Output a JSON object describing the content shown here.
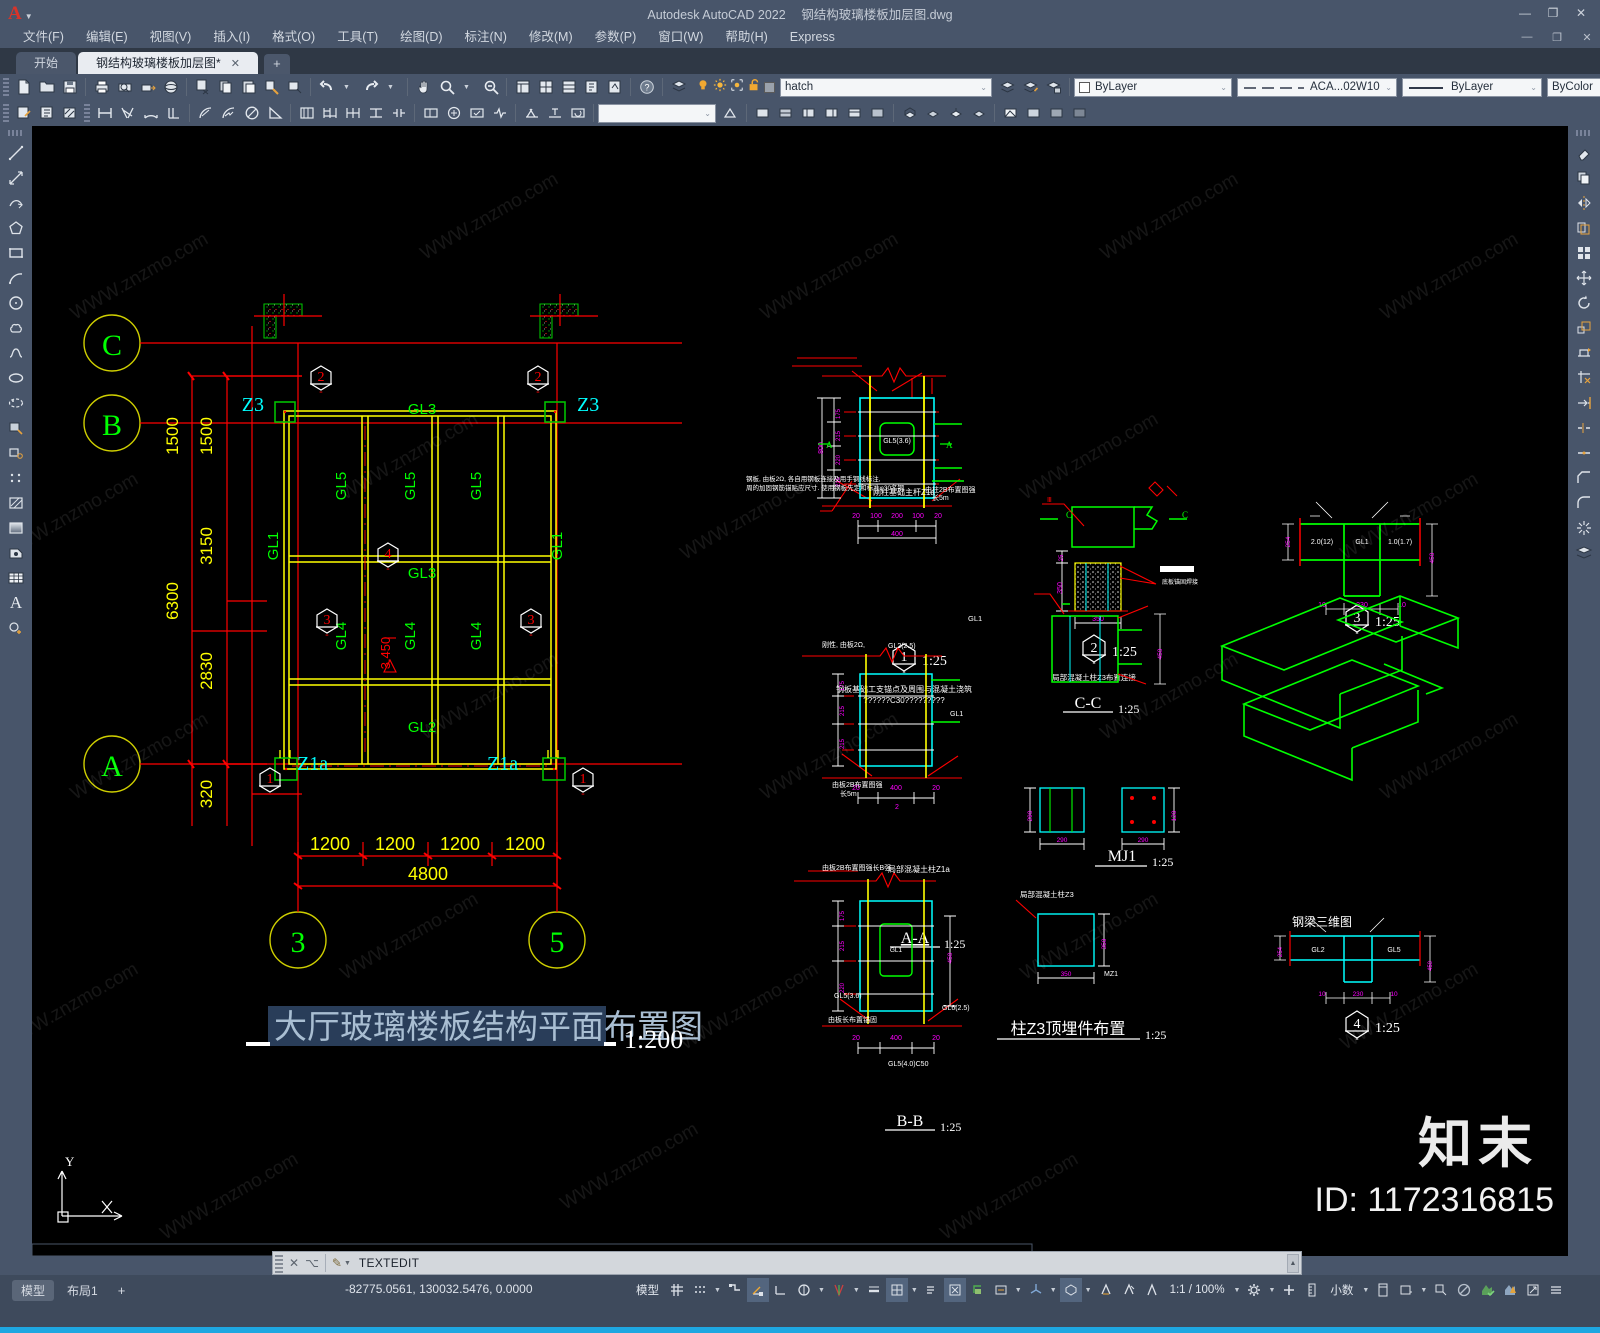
{
  "app": {
    "title": "Autodesk AutoCAD 2022",
    "document": "钢结构玻璃楼板加层图.dwg",
    "logo": "A"
  },
  "window_controls": [
    {
      "name": "minimize",
      "glyph": "—"
    },
    {
      "name": "maximize",
      "glyph": "❐"
    },
    {
      "name": "close",
      "glyph": "✕"
    }
  ],
  "menu": {
    "items": [
      {
        "label": "文件(F)",
        "name": "menu-file"
      },
      {
        "label": "编辑(E)",
        "name": "menu-edit"
      },
      {
        "label": "视图(V)",
        "name": "menu-view"
      },
      {
        "label": "插入(I)",
        "name": "menu-insert"
      },
      {
        "label": "格式(O)",
        "name": "menu-format"
      },
      {
        "label": "工具(T)",
        "name": "menu-tools"
      },
      {
        "label": "绘图(D)",
        "name": "menu-draw"
      },
      {
        "label": "标注(N)",
        "name": "menu-dimension"
      },
      {
        "label": "修改(M)",
        "name": "menu-modify"
      },
      {
        "label": "参数(P)",
        "name": "menu-parametric"
      },
      {
        "label": "窗口(W)",
        "name": "menu-window"
      },
      {
        "label": "帮助(H)",
        "name": "menu-help"
      },
      {
        "label": "Express",
        "name": "menu-express"
      }
    ],
    "right_controls": [
      {
        "glyph": "—",
        "name": "doc-minimize"
      },
      {
        "glyph": "❐",
        "name": "doc-restore"
      },
      {
        "glyph": "✕",
        "name": "doc-close"
      }
    ]
  },
  "tabs": {
    "start_label": "开始",
    "active_label": "钢结构玻璃楼板加层图*",
    "close_glyph": "✕",
    "new_tab_glyph": "+"
  },
  "properties_toolbar": {
    "layer": {
      "value": "hatch",
      "placeholder": "hatch",
      "caret": "⌄"
    },
    "color": {
      "value": "ByLayer",
      "swatch": "#ffffff"
    },
    "linetype": {
      "value": "ACA...02W10"
    },
    "lineweight": {
      "value": "ByLayer"
    },
    "plotstyle": {
      "value": "ByColor"
    }
  },
  "command_line": {
    "prompt": "TEXTEDIT",
    "close_glyph": "✕"
  },
  "status_bar": {
    "model_tab": "模型",
    "layout_tab": "布局1",
    "add_layout": "+",
    "coordinates": "-82775.0561, 130032.5476, 0.0000",
    "model_label": "模型",
    "scale": "1:1 / 100%",
    "units": "小数",
    "toggles": [
      {
        "name": "grid-display",
        "glyph": "▦",
        "on": false
      },
      {
        "name": "snap-mode",
        "glyph": "⠿",
        "on": false
      },
      {
        "name": "ortho-mode",
        "glyph": "⌐",
        "on": false
      },
      {
        "name": "polar-tracking",
        "glyph": "∠",
        "on": true
      },
      {
        "name": "isometric-drafting",
        "glyph": "⊾",
        "on": false
      },
      {
        "name": "object-snap-tracking",
        "glyph": "∅",
        "on": false
      },
      {
        "name": "object-snap",
        "glyph": "⊿",
        "on": false
      },
      {
        "name": "lineweight",
        "glyph": "≡",
        "on": false
      },
      {
        "name": "transparency",
        "glyph": "▩",
        "on": true
      },
      {
        "name": "selection-cycling",
        "glyph": "⧉",
        "on": false
      },
      {
        "name": "3d-object-snap",
        "glyph": "⟐",
        "on": false
      },
      {
        "name": "dynamic-ucs",
        "glyph": "⌗",
        "on": false
      },
      {
        "name": "annotation-visibility",
        "glyph": "⌬",
        "on": false
      },
      {
        "name": "autoscale",
        "glyph": "⤢",
        "on": false
      },
      {
        "name": "annotation-scale",
        "glyph": "⛶",
        "on": true
      }
    ]
  },
  "drawing": {
    "watermark_text": "WWW.znzmo.com",
    "watermark_brand": "知末",
    "watermark_id": "ID: 1172316815",
    "plan": {
      "title": "大厅玻璃楼板结构平面布置图",
      "title_scale": "1:200",
      "grid_labels_vertical": [
        "C",
        "B",
        "A"
      ],
      "grid_labels_horizontal": [
        "3",
        "5"
      ],
      "vertical_dimensions": [
        "1500",
        "1500",
        "3150",
        "6300",
        "2830",
        "320"
      ],
      "horizontal_dimensions": [
        "1200",
        "1200",
        "1200",
        "1200"
      ],
      "overall_dimension": "4800",
      "column_labels": [
        "Z3",
        "Z3",
        "Z1a",
        "Z1a"
      ],
      "beam_labels": [
        "GL3",
        "GL5",
        "GL5",
        "GL5",
        "GL1",
        "GL1",
        "GL3",
        "GL4",
        "GL4",
        "GL4",
        "GL2"
      ],
      "elevation": "3.450",
      "detail_bubbles": [
        "2",
        "2",
        "4",
        "3",
        "3",
        "1",
        "1"
      ]
    },
    "details": [
      {
        "name": "detail-1",
        "number": "1",
        "scale": "1:25",
        "note_cn": "钢板基础工支锚点及周围与混凝土浇筑",
        "note_cn2": "??????C30?????????",
        "labels": [
          "刚柱基础主筋Z1a",
          "由柱2B布置图强",
          "长5m",
          "GL1",
          "400",
          "200",
          "200",
          "100",
          "100",
          "20",
          "20",
          "800",
          "215",
          "220",
          "215",
          "175",
          "A",
          "A"
        ]
      },
      {
        "name": "detail-2",
        "number": "2",
        "scale": "1:25",
        "note_cn": "局部混凝土柱Z3布置连接",
        "labels": [
          "C",
          "C",
          "350",
          "350",
          "Ⅲ"
        ]
      },
      {
        "name": "detail-3",
        "number": "3",
        "scale": "1:25",
        "labels": [
          "GL1",
          "2.0(12)",
          "1.0(1.7)",
          "230",
          "10",
          "10",
          "254",
          "450"
        ]
      },
      {
        "name": "detail-4",
        "number": "4",
        "scale": "1:25",
        "labels": [
          "GL2",
          "GL5",
          "100"
        ]
      },
      {
        "name": "section-aa",
        "label": "A-A",
        "scale": "1:25",
        "labels": [
          "刚性, 由板2Ω",
          "GL2(2.5)",
          "GL1",
          "由板2B布置图强",
          "长5m",
          "400",
          "20",
          "20"
        ]
      },
      {
        "name": "section-bb",
        "label": "B-B",
        "scale": "1:25",
        "labels": [
          "由板2B布置图强长B强",
          "局部混凝土柱Z1a",
          "GL1",
          "GL5(3.6)",
          "GL6(2.5)",
          "GL5(4.0)C50"
        ]
      },
      {
        "name": "section-cc",
        "label": "C-C",
        "scale": "1:25",
        "labels": [
          "GL1"
        ]
      },
      {
        "name": "detail-mj1",
        "label": "MJ1",
        "scale": "1:25",
        "labels": [
          "290",
          "120",
          "36"
        ]
      },
      {
        "name": "detail-z3-top",
        "label": "柱Z3顶埋件布置",
        "scale": "1:25",
        "labels": [
          "局部混凝土柱Z3",
          "MZ1"
        ]
      },
      {
        "name": "detail-iso",
        "label": "钢梁三维图",
        "scale": ""
      }
    ]
  },
  "colors": {
    "canvas_bg": "#000000",
    "ui_bg": "#48556a",
    "grid_red": "#ff0000",
    "beam_yellow": "#ffff00",
    "label_green": "#00ff00",
    "column_cyan": "#00ffff",
    "dimension_magenta": "#ff00ff",
    "white": "#ffffff",
    "accent_blue": "#1ea7e1"
  }
}
